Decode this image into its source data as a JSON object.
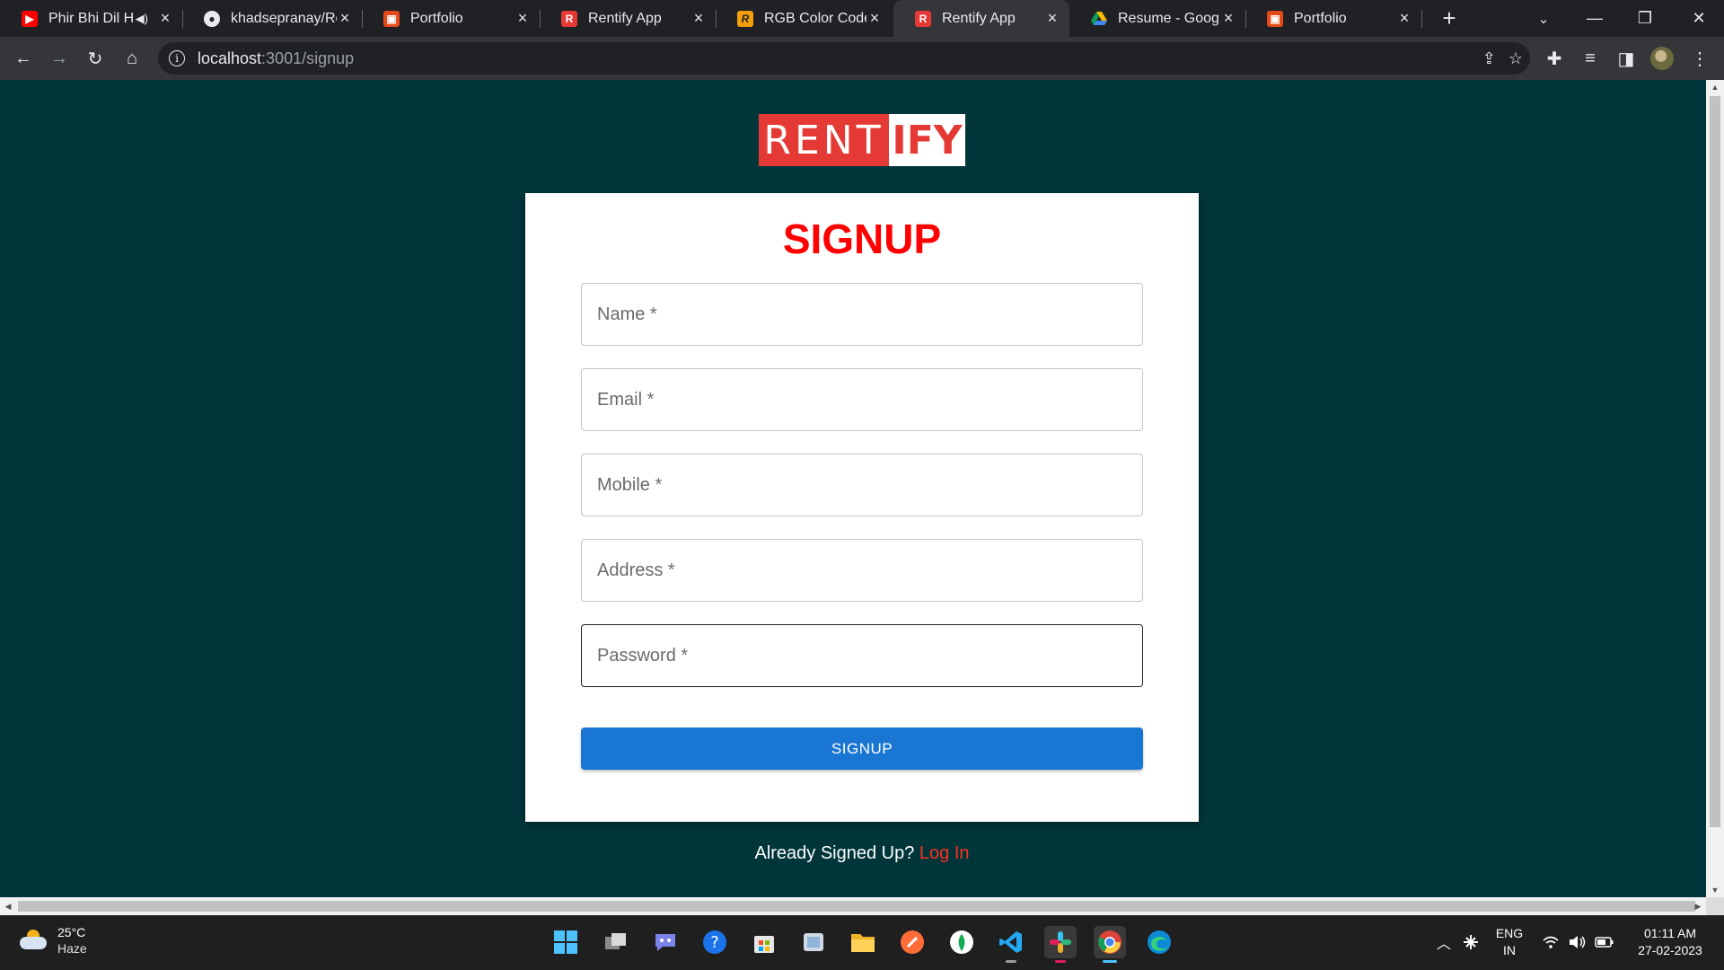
{
  "browser": {
    "tabs": [
      {
        "title": "Phir Bhi Dil H",
        "icon": "youtube-icon",
        "audio": true,
        "active": false
      },
      {
        "title": "khadsepranay/Re",
        "icon": "github-icon",
        "active": false
      },
      {
        "title": "Portfolio",
        "icon": "portfolio-icon",
        "active": false
      },
      {
        "title": "Rentify App",
        "icon": "rentify-icon",
        "active": false
      },
      {
        "title": "RGB Color Codes",
        "icon": "rgb-icon",
        "active": false
      },
      {
        "title": "Rentify App",
        "icon": "rentify-icon",
        "active": true
      },
      {
        "title": "Resume - Google",
        "icon": "google-drive-icon",
        "active": false
      },
      {
        "title": "Portfolio",
        "icon": "portfolio-icon",
        "active": false
      }
    ],
    "url": {
      "host": "localhost",
      "path": ":3001/signup"
    }
  },
  "page": {
    "logo": {
      "part1": "RENT",
      "part2": "IFY"
    },
    "title": "SIGNUP",
    "fields": {
      "name": "Name *",
      "email": "Email *",
      "mobile": "Mobile *",
      "address": "Address *",
      "password": "Password *"
    },
    "submit_label": "SIGNUP",
    "login_prompt": "Already Signed Up?",
    "login_link": "Log In"
  },
  "taskbar": {
    "weather": {
      "temp": "25°C",
      "desc": "Haze"
    },
    "language": {
      "line1": "ENG",
      "line2": "IN"
    },
    "time": "01:11 AM",
    "date": "27-02-2023"
  },
  "colors": {
    "page_bg": "#00363a",
    "title_red": "#ff0000",
    "button_blue": "#1976d2",
    "link_red": "#ff2d20"
  }
}
